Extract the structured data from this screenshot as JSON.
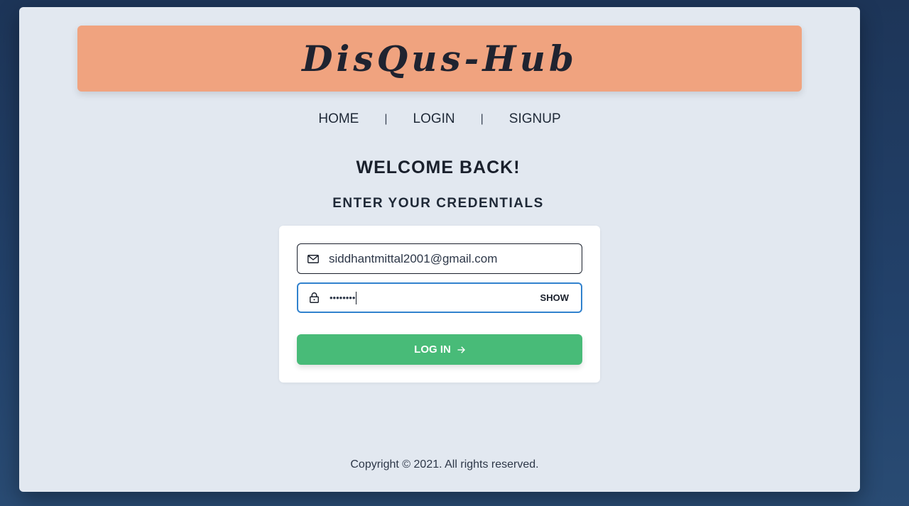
{
  "header": {
    "brand": "DisQus-Hub",
    "brand_color": "#f0a37f"
  },
  "nav": {
    "items": [
      {
        "label": "HOME"
      },
      {
        "label": "LOGIN"
      },
      {
        "label": "SIGNUP"
      }
    ],
    "separator": "|"
  },
  "main": {
    "welcome": "WELCOME BACK!",
    "subtitle": "ENTER YOUR CREDENTIALS"
  },
  "form": {
    "email": {
      "icon": "mail-icon",
      "value": "siddhantmittal2001@gmail.com"
    },
    "password": {
      "icon": "lock-icon",
      "masked_value": "••••••••",
      "show_label": "SHOW"
    },
    "login_button": {
      "label": "LOG IN",
      "icon": "arrow-right-icon",
      "color": "#48bb78"
    }
  },
  "footer": {
    "copyright": "Copyright © 2021. All rights reserved."
  }
}
